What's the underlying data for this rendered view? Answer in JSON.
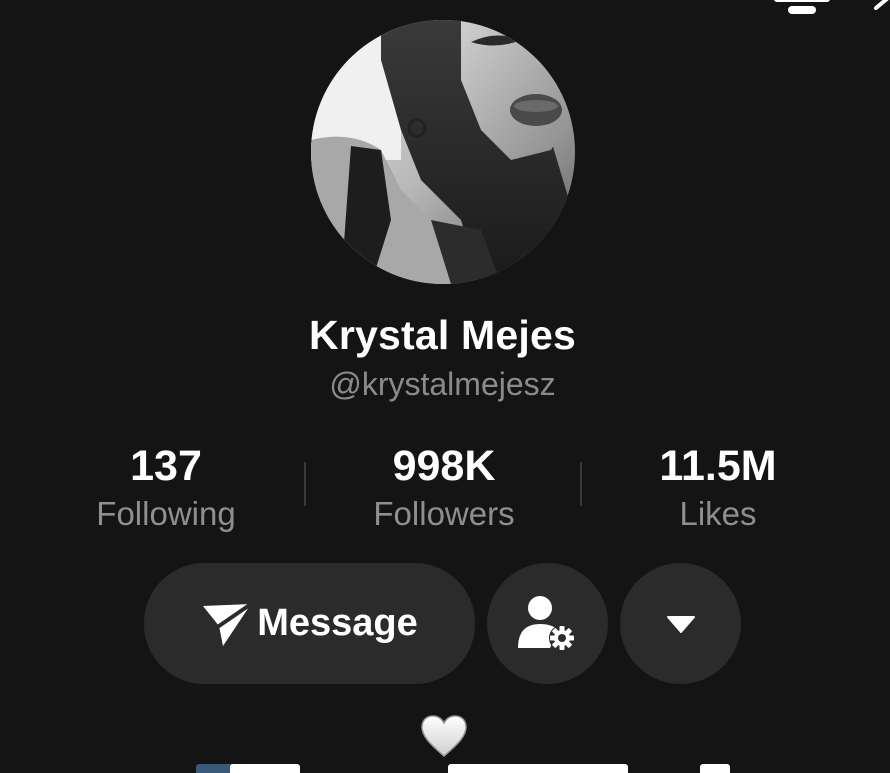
{
  "profile": {
    "display_name": "Krystal Mejes",
    "username": "@krystalmejesz"
  },
  "stats": {
    "following": {
      "value": "137",
      "label": "Following"
    },
    "followers": {
      "value": "998K",
      "label": "Followers"
    },
    "likes": {
      "value": "11.5M",
      "label": "Likes"
    }
  },
  "actions": {
    "message_label": "Message"
  },
  "icons": {
    "menu": "hamburger-menu-icon",
    "share": "share-arrow-icon",
    "message": "send-icon",
    "add_friend": "person-settings-icon",
    "more": "caret-down-icon",
    "heart": "heart-icon"
  },
  "colors": {
    "background": "#141414",
    "button": "#2b2b2b",
    "text_primary": "#ffffff",
    "text_secondary": "#8f8f8f"
  }
}
